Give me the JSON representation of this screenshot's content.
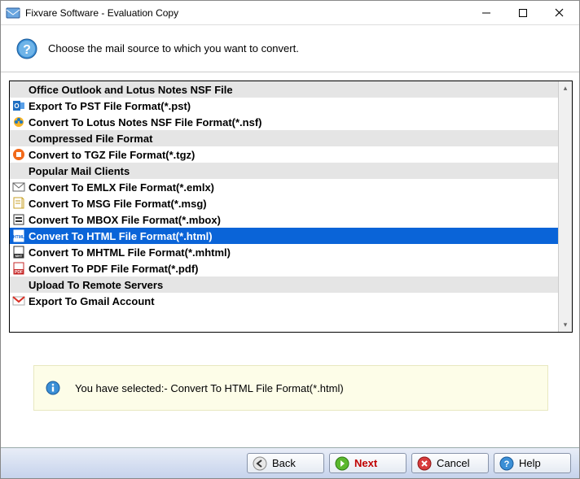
{
  "window": {
    "title": "Fixvare Software - Evaluation Copy"
  },
  "instruction": "Choose the mail source to which you want to convert.",
  "list": [
    {
      "type": "header",
      "label": "Office Outlook and Lotus Notes NSF File",
      "icon": ""
    },
    {
      "type": "item",
      "label": "Export To PST File Format(*.pst)",
      "icon": "outlook",
      "selected": false
    },
    {
      "type": "item",
      "label": "Convert To Lotus Notes NSF File Format(*.nsf)",
      "icon": "lotus",
      "selected": false
    },
    {
      "type": "header",
      "label": "Compressed File Format",
      "icon": ""
    },
    {
      "type": "item",
      "label": "Convert to TGZ File Format(*.tgz)",
      "icon": "tgz",
      "selected": false
    },
    {
      "type": "header",
      "label": "Popular Mail Clients",
      "icon": ""
    },
    {
      "type": "item",
      "label": "Convert To EMLX File Format(*.emlx)",
      "icon": "emlx",
      "selected": false
    },
    {
      "type": "item",
      "label": "Convert To MSG File Format(*.msg)",
      "icon": "msg",
      "selected": false
    },
    {
      "type": "item",
      "label": "Convert To MBOX File Format(*.mbox)",
      "icon": "mbox",
      "selected": false
    },
    {
      "type": "item",
      "label": "Convert To HTML File Format(*.html)",
      "icon": "html",
      "selected": true
    },
    {
      "type": "item",
      "label": "Convert To MHTML File Format(*.mhtml)",
      "icon": "mhtml",
      "selected": false
    },
    {
      "type": "item",
      "label": "Convert To PDF File Format(*.pdf)",
      "icon": "pdf",
      "selected": false
    },
    {
      "type": "header",
      "label": "Upload To Remote Servers",
      "icon": ""
    },
    {
      "type": "item",
      "label": "Export To Gmail Account",
      "icon": "gmail",
      "selected": false
    }
  ],
  "status": "You have selected:- Convert To HTML File Format(*.html)",
  "footer": {
    "back": "Back",
    "next": "Next",
    "cancel": "Cancel",
    "help": "Help"
  }
}
